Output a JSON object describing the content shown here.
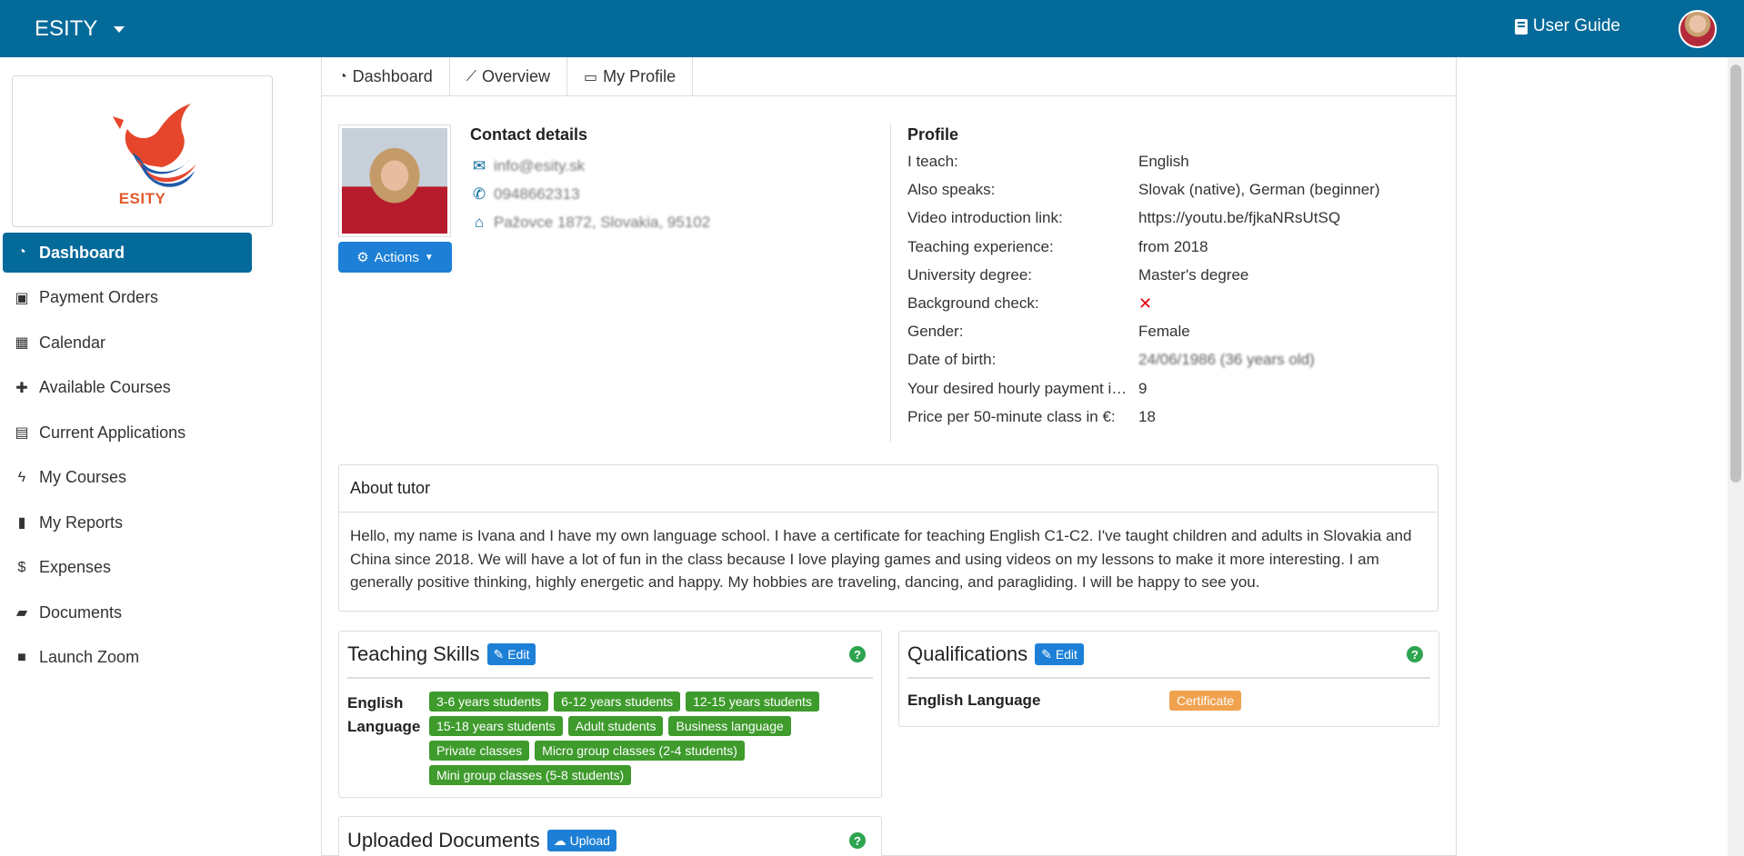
{
  "navbar": {
    "brand": "ESITY",
    "user_guide": "User Guide"
  },
  "sidebar": {
    "logo_text": "ESITY",
    "items": [
      {
        "label": "Dashboard",
        "icon": "dashboard-icon"
      },
      {
        "label": "Payment Orders",
        "icon": "money-icon"
      },
      {
        "label": "Calendar",
        "icon": "calendar-icon"
      },
      {
        "label": "Available Courses",
        "icon": "plus-icon"
      },
      {
        "label": "Current Applications",
        "icon": "document-icon"
      },
      {
        "label": "My Courses",
        "icon": "bolt-icon"
      },
      {
        "label": "My Reports",
        "icon": "file-icon"
      },
      {
        "label": "Expenses",
        "icon": "dollar-icon"
      },
      {
        "label": "Documents",
        "icon": "folder-icon"
      },
      {
        "label": "Launch Zoom",
        "icon": "video-icon"
      }
    ]
  },
  "tabs": [
    {
      "label": "Dashboard",
      "icon": "dashboard-icon"
    },
    {
      "label": "Overview",
      "icon": "line-chart-icon"
    },
    {
      "label": "My Profile",
      "icon": "id-card-icon"
    }
  ],
  "actions_label": "Actions",
  "contact": {
    "heading": "Contact details",
    "email": "info@esity.sk",
    "phone": "0948662313",
    "address": "Pažovce 1872, Slovakia, 95102"
  },
  "profile": {
    "heading": "Profile",
    "rows": [
      {
        "label": "I teach:",
        "value": "English"
      },
      {
        "label": "Also speaks:",
        "value": "Slovak (native), German (beginner)"
      },
      {
        "label": "Video introduction link:",
        "value": "https://youtu.be/fjkaNRsUtSQ"
      },
      {
        "label": "Teaching experience:",
        "value": "from 2018"
      },
      {
        "label": "University degree:",
        "value": "Master's degree"
      },
      {
        "label": "Background check:",
        "value": "✕"
      },
      {
        "label": "Gender:",
        "value": "Female"
      },
      {
        "label": "Date of birth:",
        "value": "24/06/1986 (36 years old)"
      },
      {
        "label": "Your desired hourly payment in €:",
        "value": "9"
      },
      {
        "label": "Price per 50-minute class in €:",
        "value": "18"
      }
    ]
  },
  "about": {
    "heading": "About tutor",
    "text": "Hello, my name is Ivana and I have my own language school. I have a certificate for teaching English C1-C2. I've taught children and adults in Slovakia and China since 2018. We will have a lot of fun in the class because I love playing games and using videos on my lessons to make it more interesting. I am generally positive thinking, highly energetic and happy. My hobbies are traveling, dancing, and paragliding. I will be happy to see you."
  },
  "teaching_skills": {
    "title": "Teaching Skills",
    "edit_label": "Edit",
    "language": "English Language",
    "tags": [
      "3-6 years students",
      "6-12 years students",
      "12-15 years students",
      "15-18 years students",
      "Adult students",
      "Business language",
      "Private classes",
      "Micro group classes (2-4 students)",
      "Mini group classes (5-8 students)"
    ]
  },
  "qualifications": {
    "title": "Qualifications",
    "edit_label": "Edit",
    "language": "English Language",
    "badge": "Certificate"
  },
  "uploaded_documents": {
    "title": "Uploaded Documents",
    "upload_label": "Upload"
  },
  "colors": {
    "primary": "#046a9a",
    "button": "#1d80d6",
    "tag_green": "#3e9b2c",
    "cert_orange": "#f0a24f",
    "help_green": "#2ea44f"
  }
}
